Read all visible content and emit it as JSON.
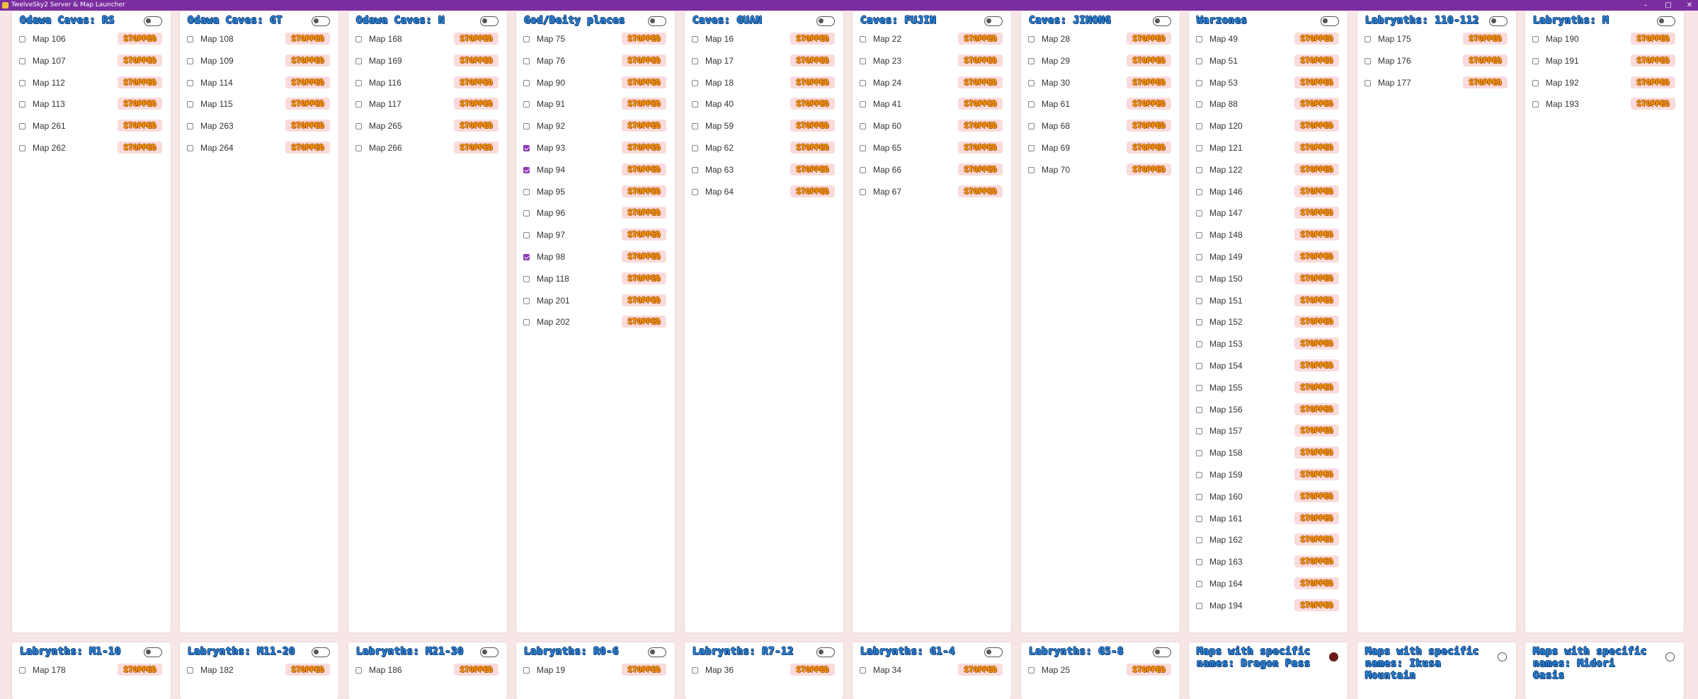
{
  "window": {
    "title": "TwelveSky2 Server & Map Launcher",
    "controls": {
      "minimize": "–",
      "maximize": "□",
      "close": "✕"
    }
  },
  "status_label": "STOPPED",
  "colors": {
    "accent_purple": "#8e3ab6",
    "title_bar": "#7a2ea0",
    "status_text": "#f5a11c",
    "status_bg": "#fadada",
    "heading": "#2e86d6"
  },
  "panels": [
    {
      "title": "Odawa Caves: RS",
      "control": "toggle",
      "maps": [
        {
          "label": "Map 106",
          "checked": false
        },
        {
          "label": "Map 107",
          "checked": false
        },
        {
          "label": "Map 112",
          "checked": false
        },
        {
          "label": "Map 113",
          "checked": false
        },
        {
          "label": "Map 261",
          "checked": false
        },
        {
          "label": "Map 262",
          "checked": false
        }
      ]
    },
    {
      "title": "Odawa Caves: GT",
      "control": "toggle",
      "maps": [
        {
          "label": "Map 108",
          "checked": false
        },
        {
          "label": "Map 109",
          "checked": false
        },
        {
          "label": "Map 114",
          "checked": false
        },
        {
          "label": "Map 115",
          "checked": false
        },
        {
          "label": "Map 263",
          "checked": false
        },
        {
          "label": "Map 264",
          "checked": false
        }
      ]
    },
    {
      "title": "Odawa Caves: N",
      "control": "toggle",
      "maps": [
        {
          "label": "Map 168",
          "checked": false
        },
        {
          "label": "Map 169",
          "checked": false
        },
        {
          "label": "Map 116",
          "checked": false
        },
        {
          "label": "Map 117",
          "checked": false
        },
        {
          "label": "Map 265",
          "checked": false
        },
        {
          "label": "Map 266",
          "checked": false
        }
      ]
    },
    {
      "title": "God/Deity places",
      "control": "toggle",
      "maps": [
        {
          "label": "Map 75",
          "checked": false
        },
        {
          "label": "Map 76",
          "checked": false
        },
        {
          "label": "Map 90",
          "checked": false
        },
        {
          "label": "Map 91",
          "checked": false
        },
        {
          "label": "Map 92",
          "checked": false
        },
        {
          "label": "Map 93",
          "checked": true
        },
        {
          "label": "Map 94",
          "checked": true
        },
        {
          "label": "Map 95",
          "checked": false
        },
        {
          "label": "Map 96",
          "checked": false
        },
        {
          "label": "Map 97",
          "checked": false
        },
        {
          "label": "Map 98",
          "checked": true
        },
        {
          "label": "Map 118",
          "checked": false
        },
        {
          "label": "Map 201",
          "checked": false
        },
        {
          "label": "Map 202",
          "checked": false
        }
      ]
    },
    {
      "title": "Caves: GUAN",
      "control": "toggle",
      "maps": [
        {
          "label": "Map 16",
          "checked": false
        },
        {
          "label": "Map 17",
          "checked": false
        },
        {
          "label": "Map 18",
          "checked": false
        },
        {
          "label": "Map 40",
          "checked": false
        },
        {
          "label": "Map 59",
          "checked": false
        },
        {
          "label": "Map 62",
          "checked": false
        },
        {
          "label": "Map 63",
          "checked": false
        },
        {
          "label": "Map 64",
          "checked": false
        }
      ]
    },
    {
      "title": "Caves: FUJIN",
      "control": "toggle",
      "maps": [
        {
          "label": "Map 22",
          "checked": false
        },
        {
          "label": "Map 23",
          "checked": false
        },
        {
          "label": "Map 24",
          "checked": false
        },
        {
          "label": "Map 41",
          "checked": false
        },
        {
          "label": "Map 60",
          "checked": false
        },
        {
          "label": "Map 65",
          "checked": false
        },
        {
          "label": "Map 66",
          "checked": false
        },
        {
          "label": "Map 67",
          "checked": false
        }
      ]
    },
    {
      "title": "Caves: JINONG",
      "control": "toggle",
      "maps": [
        {
          "label": "Map 28",
          "checked": false
        },
        {
          "label": "Map 29",
          "checked": false
        },
        {
          "label": "Map 30",
          "checked": false
        },
        {
          "label": "Map 61",
          "checked": false
        },
        {
          "label": "Map 68",
          "checked": false
        },
        {
          "label": "Map 69",
          "checked": false
        },
        {
          "label": "Map 70",
          "checked": false
        }
      ]
    },
    {
      "title": "Warzones",
      "control": "toggle",
      "maps": [
        {
          "label": "Map 49",
          "checked": false
        },
        {
          "label": "Map 51",
          "checked": false
        },
        {
          "label": "Map 53",
          "checked": false
        },
        {
          "label": "Map 88",
          "checked": false
        },
        {
          "label": "Map 120",
          "checked": false
        },
        {
          "label": "Map 121",
          "checked": false
        },
        {
          "label": "Map 122",
          "checked": false
        },
        {
          "label": "Map 146",
          "checked": false
        },
        {
          "label": "Map 147",
          "checked": false
        },
        {
          "label": "Map 148",
          "checked": false
        },
        {
          "label": "Map 149",
          "checked": false
        },
        {
          "label": "Map 150",
          "checked": false
        },
        {
          "label": "Map 151",
          "checked": false
        },
        {
          "label": "Map 152",
          "checked": false
        },
        {
          "label": "Map 153",
          "checked": false
        },
        {
          "label": "Map 154",
          "checked": false
        },
        {
          "label": "Map 155",
          "checked": false
        },
        {
          "label": "Map 156",
          "checked": false
        },
        {
          "label": "Map 157",
          "checked": false
        },
        {
          "label": "Map 158",
          "checked": false
        },
        {
          "label": "Map 159",
          "checked": false
        },
        {
          "label": "Map 160",
          "checked": false
        },
        {
          "label": "Map 161",
          "checked": false
        },
        {
          "label": "Map 162",
          "checked": false
        },
        {
          "label": "Map 163",
          "checked": false
        },
        {
          "label": "Map 164",
          "checked": false
        },
        {
          "label": "Map 194",
          "checked": false
        }
      ]
    },
    {
      "title": "Labrynths: 110-112",
      "control": "toggle",
      "maps": [
        {
          "label": "Map 175",
          "checked": false
        },
        {
          "label": "Map 176",
          "checked": false
        },
        {
          "label": "Map 177",
          "checked": false
        }
      ]
    },
    {
      "title": "Labrynths: M",
      "control": "toggle",
      "maps": [
        {
          "label": "Map 190",
          "checked": false
        },
        {
          "label": "Map 191",
          "checked": false
        },
        {
          "label": "Map 192",
          "checked": false
        },
        {
          "label": "Map 193",
          "checked": false
        }
      ]
    },
    {
      "title": "Labrynths: M1-10",
      "control": "toggle",
      "maps": [
        {
          "label": "Map 178",
          "checked": false
        }
      ]
    },
    {
      "title": "Labrynths: M11-20",
      "control": "toggle",
      "maps": [
        {
          "label": "Map 182",
          "checked": false
        }
      ]
    },
    {
      "title": "Labrynths: M21-30",
      "control": "toggle",
      "maps": [
        {
          "label": "Map 186",
          "checked": false
        }
      ]
    },
    {
      "title": "Labrynths: R0-6",
      "control": "toggle",
      "maps": [
        {
          "label": "Map 19",
          "checked": false
        }
      ]
    },
    {
      "title": "Labrynths: R7-12",
      "control": "toggle",
      "maps": [
        {
          "label": "Map 36",
          "checked": false
        }
      ]
    },
    {
      "title": "Labrynths: G1-4",
      "control": "toggle",
      "maps": [
        {
          "label": "Map 34",
          "checked": false
        }
      ]
    },
    {
      "title": "Labrynths: G5-8",
      "control": "toggle",
      "maps": [
        {
          "label": "Map 25",
          "checked": false
        }
      ]
    },
    {
      "title": "Maps with specific names: Dragon Pass",
      "control": "radio",
      "selected": true,
      "maps": []
    },
    {
      "title": "Maps with specific names: Ikusa Mountain",
      "control": "radio",
      "selected": false,
      "maps": []
    },
    {
      "title": "Maps with specific names: Midori Oasis",
      "control": "radio",
      "selected": false,
      "maps": []
    }
  ]
}
